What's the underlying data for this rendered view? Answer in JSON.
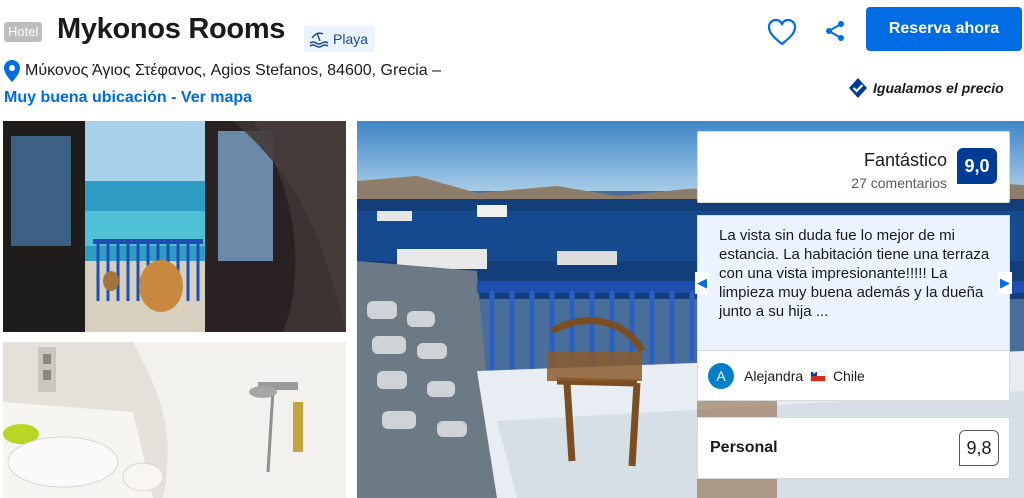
{
  "header": {
    "badge": "Hotel",
    "title": "Mykonos Rooms",
    "beach_tag": "Playa",
    "beach_icon": "beach-icon",
    "reserve_label": "Reserva ahora",
    "favorite_icon": "heart-icon",
    "share_icon": "share-icon"
  },
  "address": {
    "pin_icon": "map-pin-icon",
    "text": "Μύκονος Άγιος Στέφανος, Agios Stefanos, 84600, Grecia –",
    "map_link": "Muy buena ubicación - Ver mapa"
  },
  "price_match": {
    "icon": "badge-check-icon",
    "label": "Igualamos el precio"
  },
  "review": {
    "rating_label": "Fantástico",
    "review_count": "27 comentarios",
    "score": "9,0",
    "quote": "La vista sin duda fue lo mejor de mi estancia. La habitación tiene una terraza con una vista impresionante!!!!! La limpieza muy buena además y la dueña junto a su hija ...",
    "reviewer_initial": "A",
    "reviewer_name": "Alejandra",
    "reviewer_country": "Chile",
    "category_label": "Personal",
    "category_score": "9,8"
  },
  "colors": {
    "primary": "#006ce4",
    "score_badge": "#003b95",
    "quote_bg": "#ebf3ff",
    "avatar": "#007fc8"
  }
}
